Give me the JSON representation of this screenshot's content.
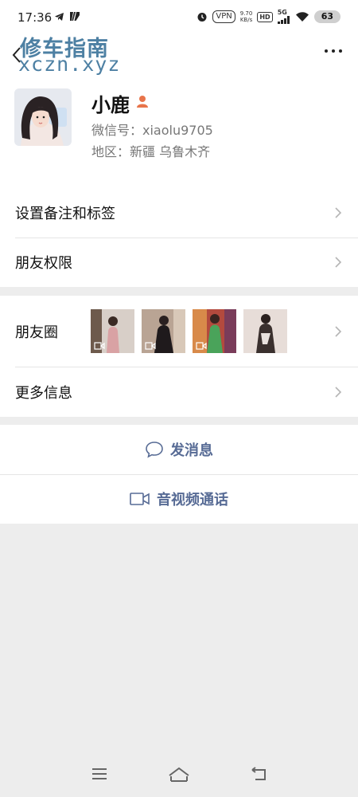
{
  "status": {
    "time": "17:36",
    "vpn": "VPN",
    "speed_value": "9.70",
    "speed_unit": "KB/s",
    "hd": "HD",
    "network": "5G",
    "battery": "63"
  },
  "header": {
    "watermark_text": "修车指南",
    "watermark_url": "xczn.xyz"
  },
  "profile": {
    "name": "小鹿",
    "wechat_id": "微信号：xiaolu9705",
    "region": "地区：新疆  乌鲁木齐",
    "gender_icon": "female-user-icon",
    "gender_color": "#e8744a"
  },
  "menu": {
    "set_remark": "设置备注和标签",
    "friend_permission": "朋友权限",
    "moments": "朋友圈",
    "more_info": "更多信息"
  },
  "actions": {
    "send_message": "发消息",
    "video_call": "音视频通话"
  },
  "colors": {
    "link": "#576b95",
    "background": "#ededed",
    "watermark": "#2f6a94"
  }
}
